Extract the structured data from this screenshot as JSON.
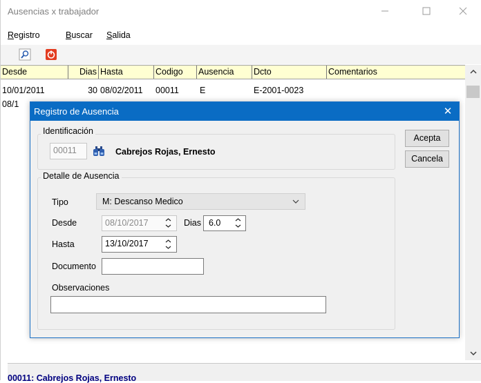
{
  "window": {
    "title": "Ausencias x trabajador"
  },
  "menu": [
    {
      "mnemonic": "R",
      "rest": "egistro"
    },
    {
      "mnemonic": "B",
      "rest": "uscar"
    },
    {
      "mnemonic": "S",
      "rest": "alida"
    }
  ],
  "toolbar": {
    "icons": [
      "search-icon",
      "power-icon"
    ]
  },
  "grid": {
    "columns": [
      "Desde",
      "Dias",
      "Hasta",
      "Codigo",
      "Ausencia",
      "Dcto",
      "Comentarios"
    ],
    "rows": [
      {
        "desde": "10/01/2011",
        "dias": "30",
        "hasta": "08/02/2011",
        "codigo": "00011",
        "ausencia": "E",
        "dcto": "E-2001-0023",
        "comentarios": ""
      },
      {
        "desde": "08/1",
        "dias": "",
        "hasta": "",
        "codigo": "",
        "ausencia": "",
        "dcto": "",
        "comentarios": ""
      }
    ]
  },
  "status": {
    "text": "00011: Cabrejos Rojas, Ernesto"
  },
  "dialog": {
    "title": "Registro de Ausencia",
    "close_glyph": "✕",
    "identificacion": {
      "legend": "Identificación",
      "code": "00011",
      "name": "Cabrejos Rojas, Ernesto"
    },
    "detalle": {
      "legend": "Detalle de Ausencia",
      "tipo_label": "Tipo",
      "tipo_value": "M: Descanso Medico",
      "desde_label": "Desde",
      "desde_value": "08/10/2017",
      "dias_label": "Dias",
      "dias_value": "6.0",
      "hasta_label": "Hasta",
      "hasta_value": "13/10/2017",
      "documento_label": "Documento",
      "documento_value": "",
      "observaciones_label": "Observaciones",
      "observaciones_value": ""
    },
    "buttons": {
      "acepta": "Acepta",
      "cancela": "Cancela"
    }
  },
  "colors": {
    "dialog_title_bg": "#0a6cc4",
    "grid_header_bg": "#ffffd2",
    "status_text": "#000080"
  }
}
